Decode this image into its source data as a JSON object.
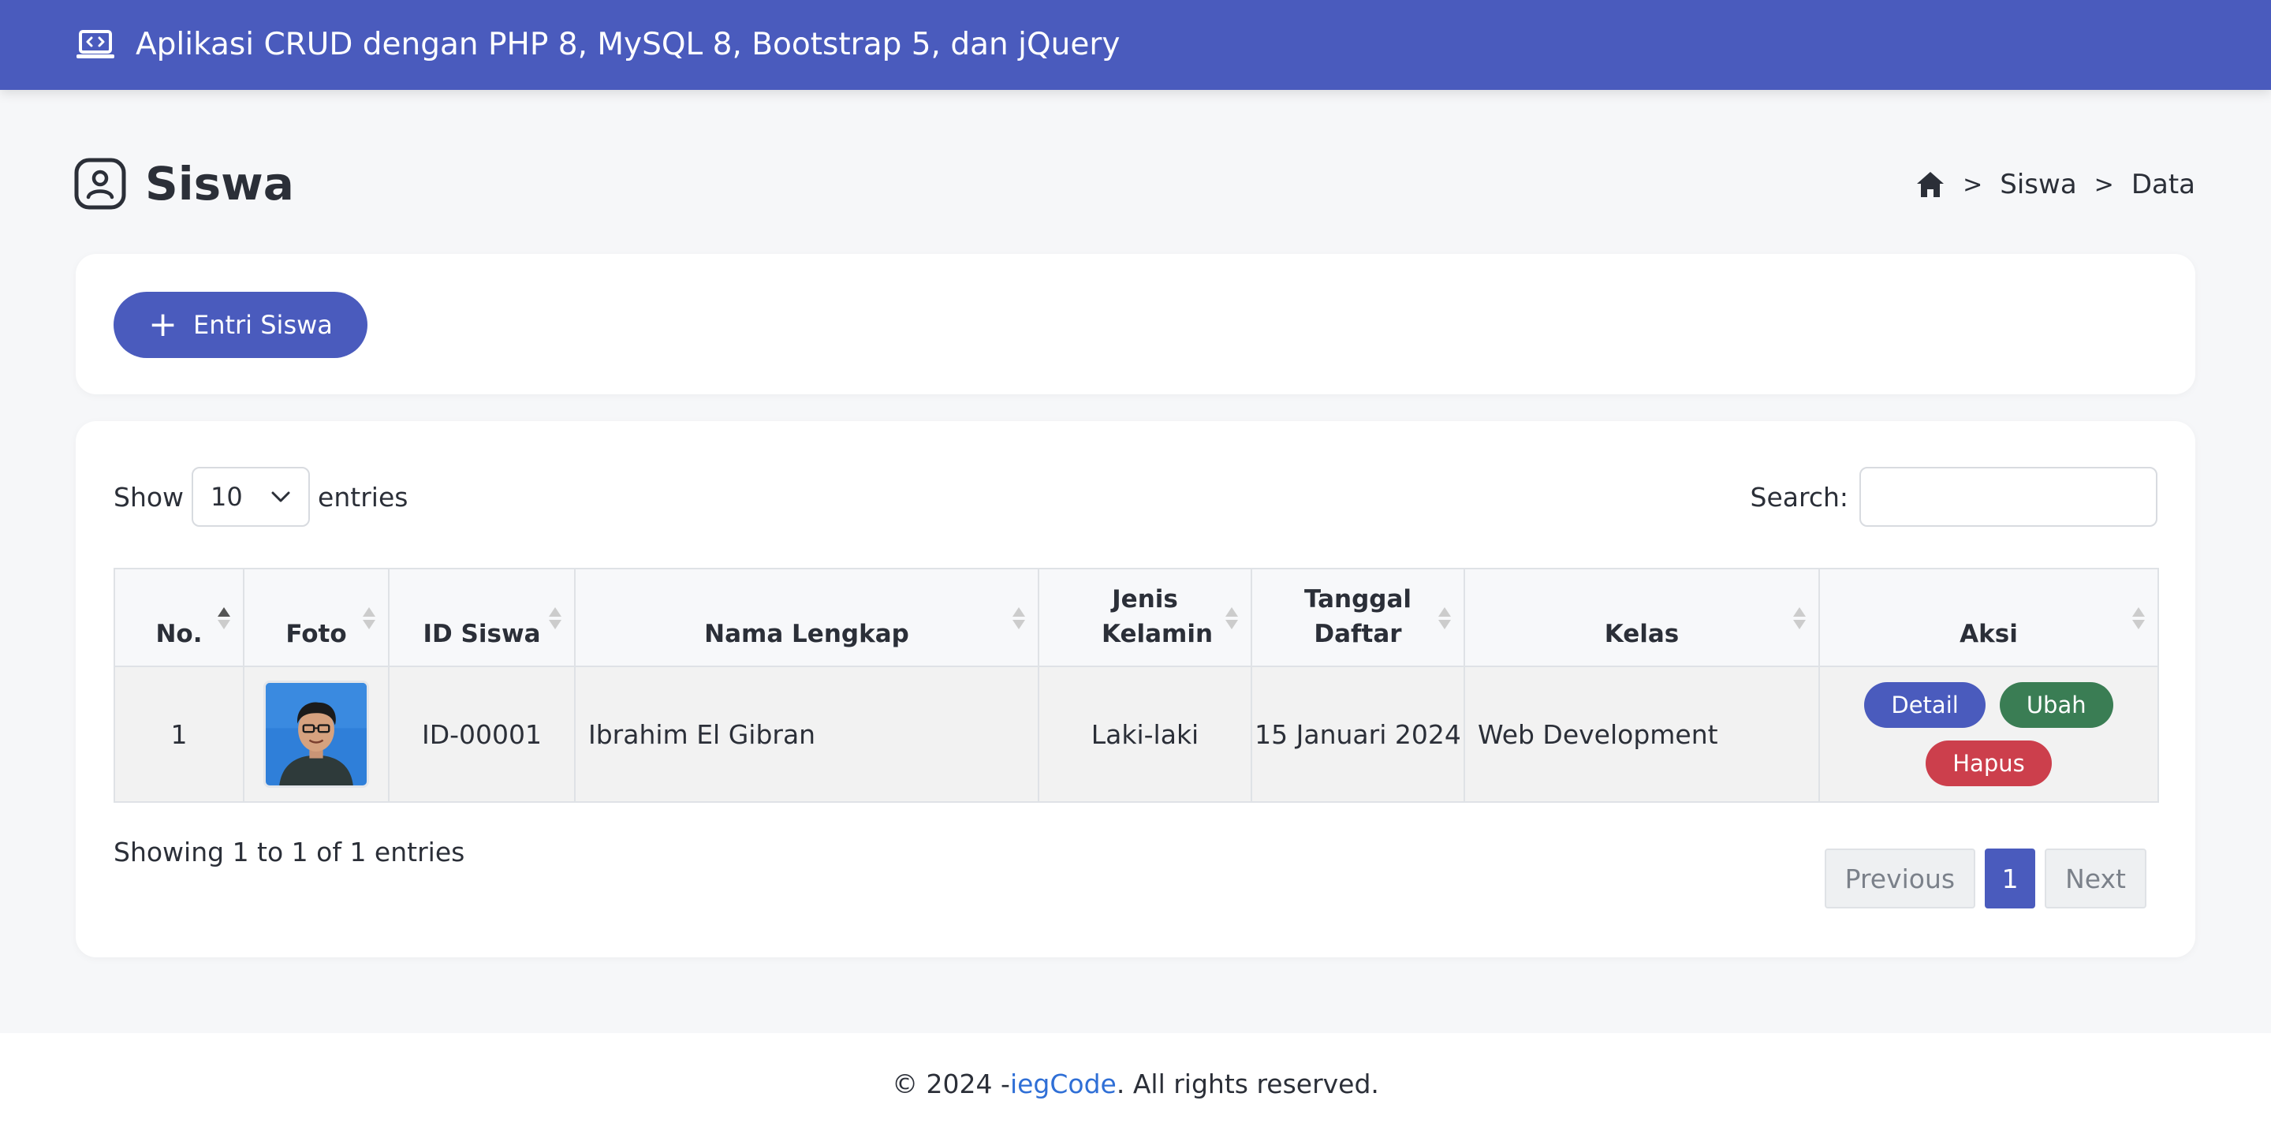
{
  "navbar": {
    "title": "Aplikasi CRUD dengan PHP 8, MySQL 8, Bootstrap 5, dan jQuery",
    "icon": "laptop-code-icon"
  },
  "page": {
    "title": "Siswa",
    "icon": "user-square-icon"
  },
  "breadcrumb": {
    "items": [
      "Siswa",
      "Data"
    ]
  },
  "actions": {
    "add_label": "Entri Siswa"
  },
  "datatable": {
    "length": {
      "prefix": "Show",
      "value": "10",
      "suffix": "entries"
    },
    "search": {
      "label": "Search:",
      "value": ""
    },
    "columns": [
      "No.",
      "Foto",
      "ID Siswa",
      "Nama Lengkap",
      "Jenis Kelamin",
      "Tanggal Daftar",
      "Kelas",
      "Aksi"
    ],
    "rows": [
      {
        "no": "1",
        "id": "ID-00001",
        "nama": "Ibrahim El Gibran",
        "jenis_kelamin": "Laki-laki",
        "tanggal_daftar": "15 Januari 2024",
        "kelas": "Web Development"
      }
    ],
    "row_actions": {
      "detail": "Detail",
      "ubah": "Ubah",
      "hapus": "Hapus"
    },
    "info": "Showing 1 to 1 of 1 entries",
    "pagination": {
      "previous": "Previous",
      "current": "1",
      "next": "Next"
    }
  },
  "footer": {
    "prefix": "© 2024 - ",
    "link": "iegCode",
    "suffix": ". All rights reserved."
  },
  "colors": {
    "primary": "#4a5bbd",
    "success": "#3a7d54",
    "danger": "#cc3f4c",
    "link": "#2f6fd6"
  }
}
